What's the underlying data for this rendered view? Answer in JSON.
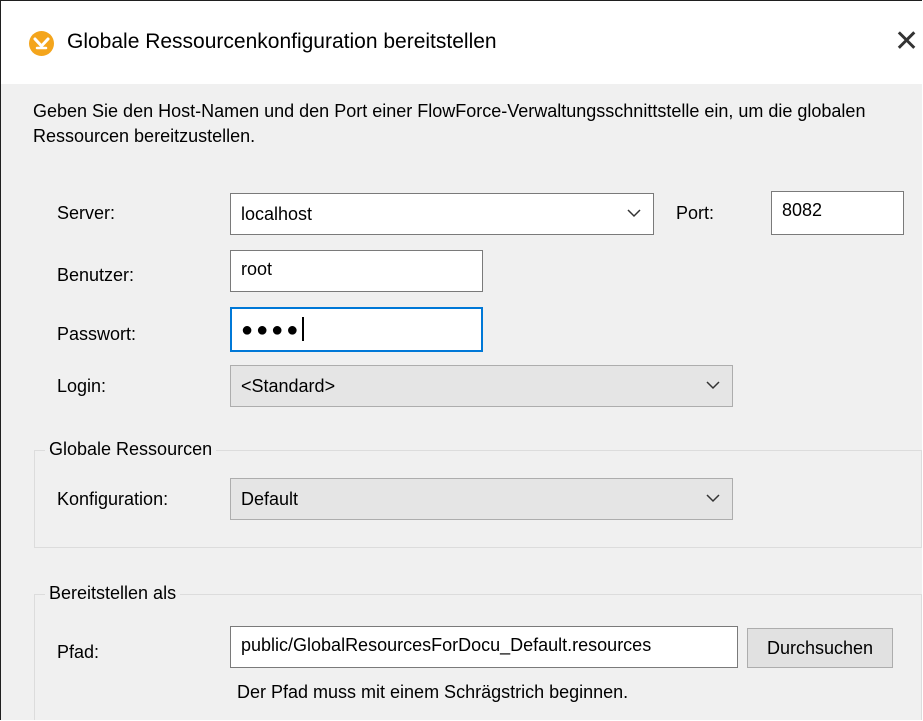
{
  "window": {
    "title": "Globale Ressourcenkonfiguration bereitstellen",
    "icon": "altova-app-icon",
    "close_icon": "close-icon"
  },
  "intro_text": "Geben Sie den Host-Namen und den Port einer FlowForce-Verwaltungsschnittstelle ein, um die globalen Ressourcen bereitzustellen.",
  "form": {
    "server_label": "Server:",
    "server_value": "localhost",
    "port_label": "Port:",
    "port_value": "8082",
    "user_label": "Benutzer:",
    "user_value": "root",
    "password_label": "Passwort:",
    "password_masked": "●●●●",
    "login_label": "Login:",
    "login_value": "<Standard>"
  },
  "global_resources": {
    "group_title": "Globale Ressourcen",
    "config_label": "Konfiguration:",
    "config_value": "Default"
  },
  "deploy_as": {
    "group_title": "Bereitstellen als",
    "path_label": "Pfad:",
    "path_value": "public/GlobalResourcesForDocu_Default.resources",
    "browse_label": "Durchsuchen",
    "hint": "Der Pfad muss mit einem Schrägstrich beginnen."
  },
  "colors": {
    "focus_border": "#0078d7",
    "dialog_bg": "#f0f0f0",
    "icon_accent": "#f4a51c"
  }
}
